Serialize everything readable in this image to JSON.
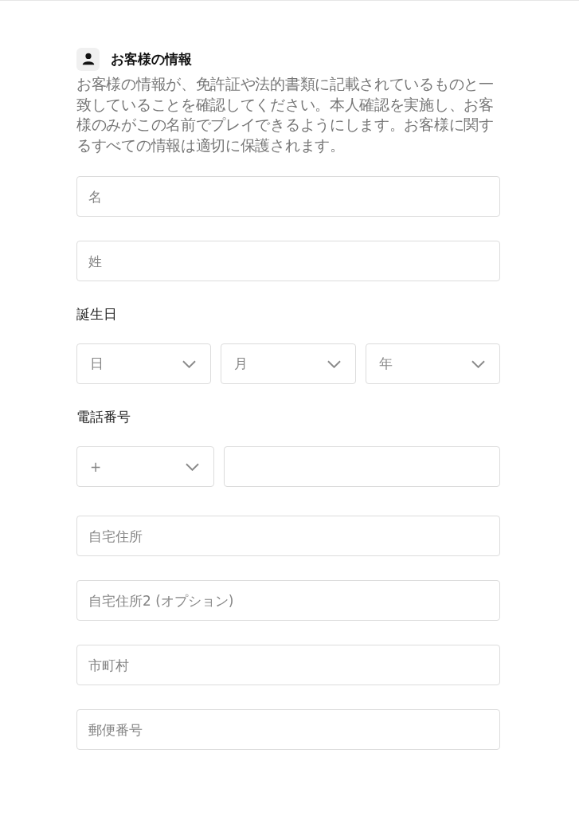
{
  "section": {
    "title": "お客様の情報",
    "description": "お客様の情報が、免許証や法的書類に記載されているものと一致していることを確認してください。本人確認を実施し、お客様のみがこの名前でプレイできるようにします。お客様に関するすべての情報は適切に保護されます。"
  },
  "first_name": {
    "placeholder": "名"
  },
  "last_name": {
    "placeholder": "姓"
  },
  "birthday": {
    "label": "誕生日",
    "selects": [
      {
        "placeholder": "日"
      },
      {
        "placeholder": "月"
      },
      {
        "placeholder": "年"
      }
    ]
  },
  "phone": {
    "label": "電話番号",
    "country_code": {
      "placeholder": "+"
    }
  },
  "address_fields": [
    {
      "placeholder": "自宅住所"
    },
    {
      "placeholder": "自宅住所2 (オプション)"
    },
    {
      "placeholder": "市町村"
    },
    {
      "placeholder": "郵便番号"
    }
  ]
}
